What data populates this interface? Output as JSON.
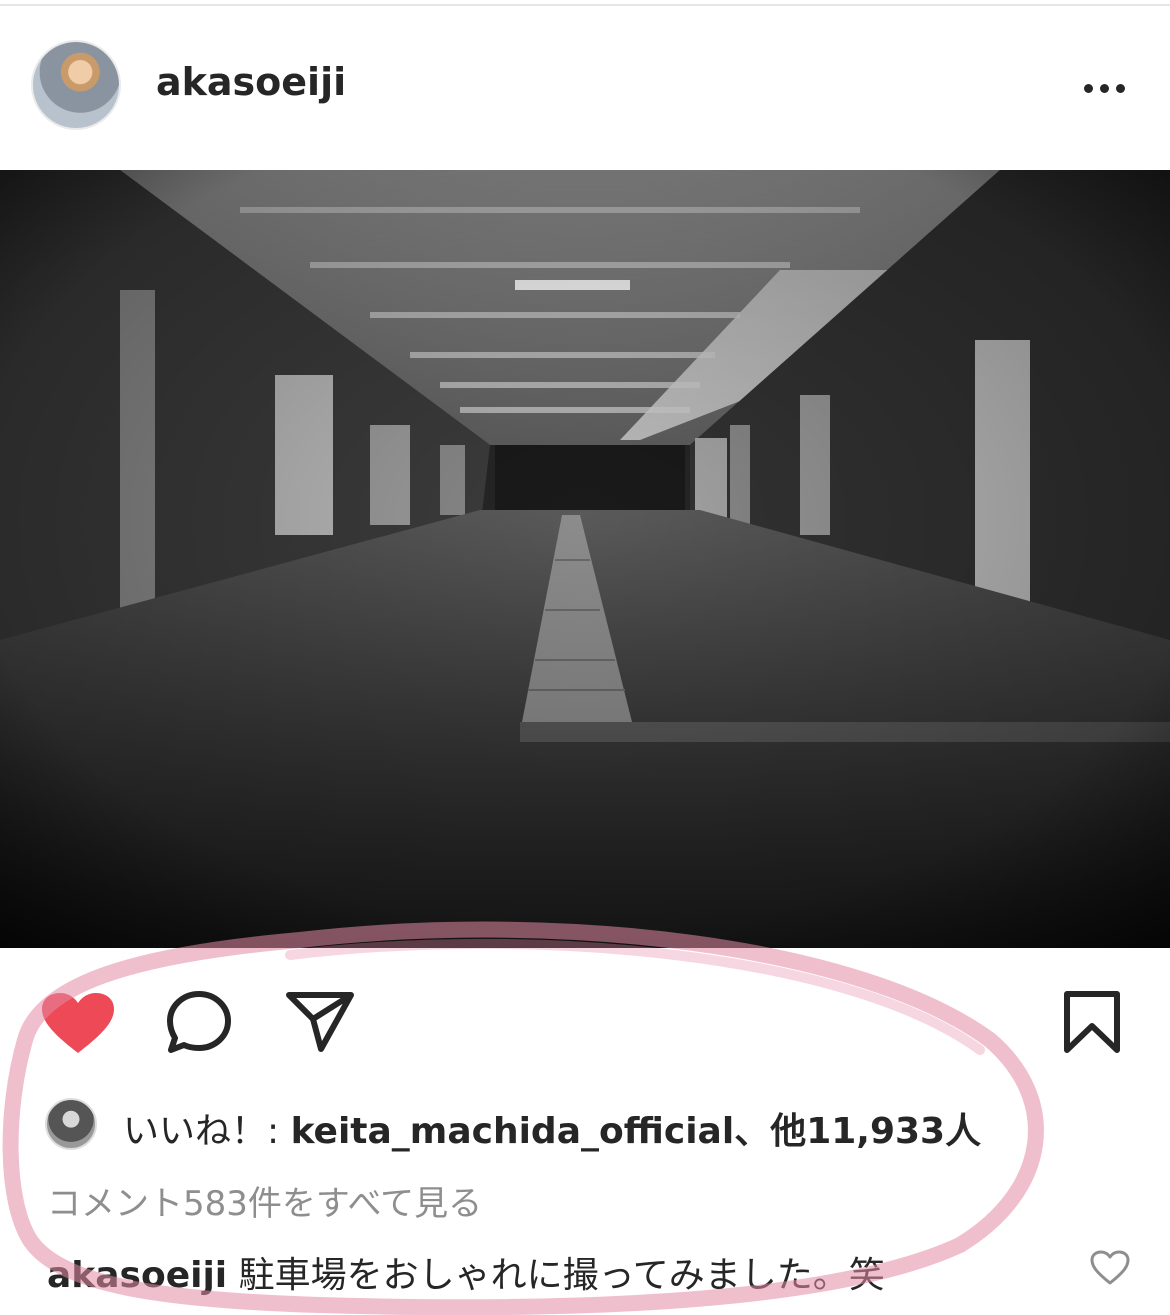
{
  "post": {
    "username": "akasoeiji",
    "likes_prefix": "いいね！: ",
    "liker": "keita_machida_official",
    "likes_suffix": "、他11,933人",
    "view_comments": "コメント583件をすべて見る",
    "caption_user": "akasoeiji",
    "caption_text": " 駐車場をおしゃれに撮ってみました。笑"
  },
  "icons": {
    "more": "more-horizontal-icon",
    "like": "heart-filled-icon",
    "comment": "comment-icon",
    "share": "send-icon",
    "save": "bookmark-icon",
    "comment_like": "heart-outline-icon"
  },
  "colors": {
    "like_red": "#ed4956",
    "highlight_pink": "#e48aa6"
  }
}
